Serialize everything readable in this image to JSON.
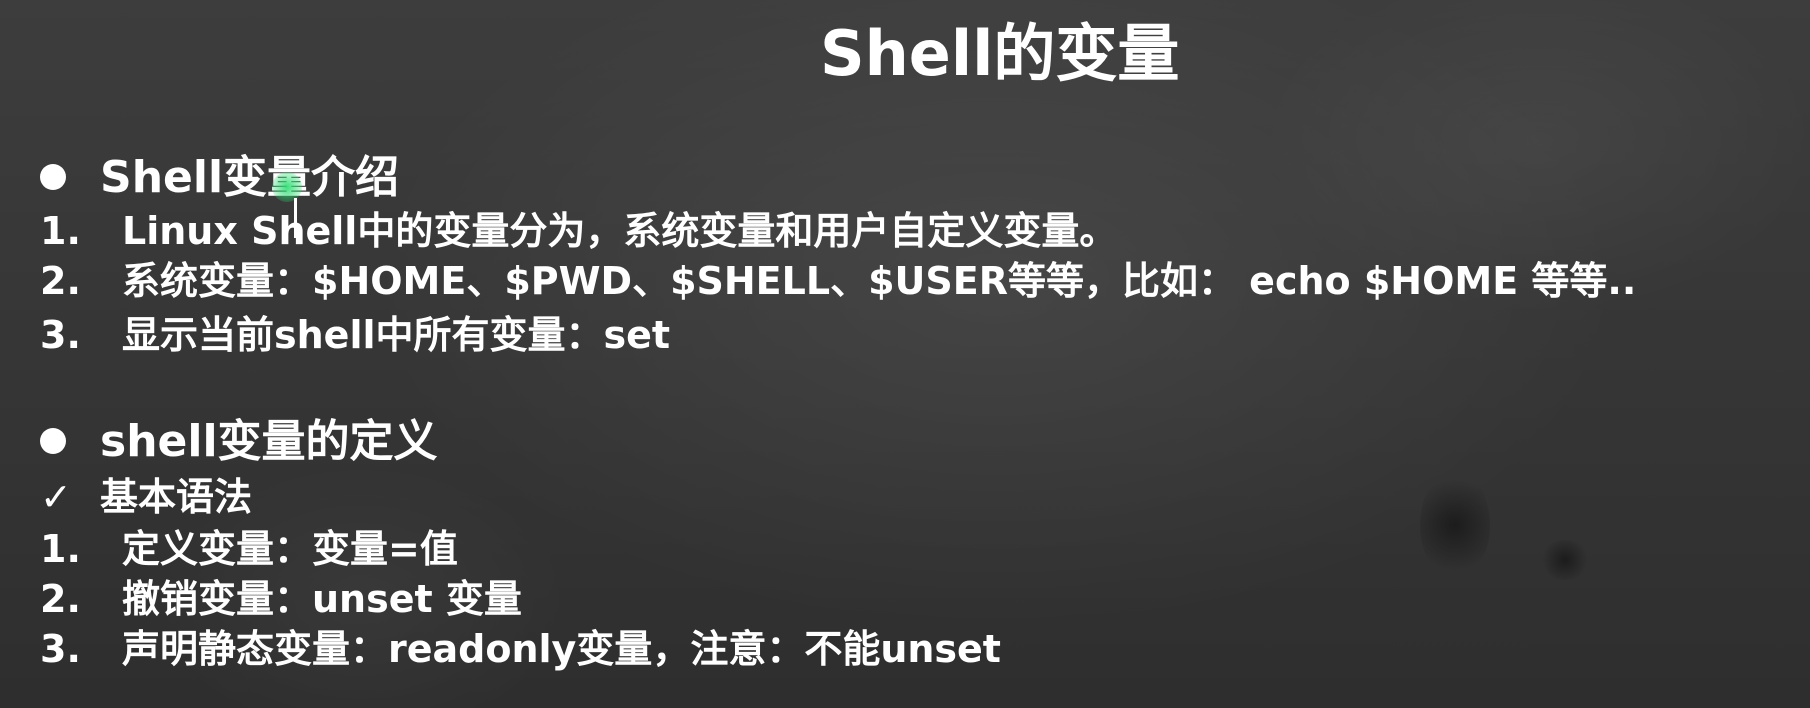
{
  "slide": {
    "title": "Shell的变量",
    "section1": {
      "heading": "Shell变量介绍",
      "items": [
        {
          "num": "1.",
          "text": "Linux Shell中的变量分为，系统变量和用户自定义变量。"
        },
        {
          "num": "2.",
          "text": "系统变量：$HOME、$PWD、$SHELL、$USER等等，比如： echo $HOME   等等.."
        },
        {
          "num": "3.",
          "text": "显示当前shell中所有变量：set"
        }
      ]
    },
    "section2": {
      "heading": "shell变量的定义",
      "check_mark": "✓",
      "subheading": "基本语法",
      "items": [
        {
          "num": "1.",
          "text": "定义变量：变量=值"
        },
        {
          "num": "2.",
          "text": "撤销变量：unset 变量"
        },
        {
          "num": "3.",
          "text": "声明静态变量：readonly变量，注意：不能unset"
        }
      ]
    }
  }
}
